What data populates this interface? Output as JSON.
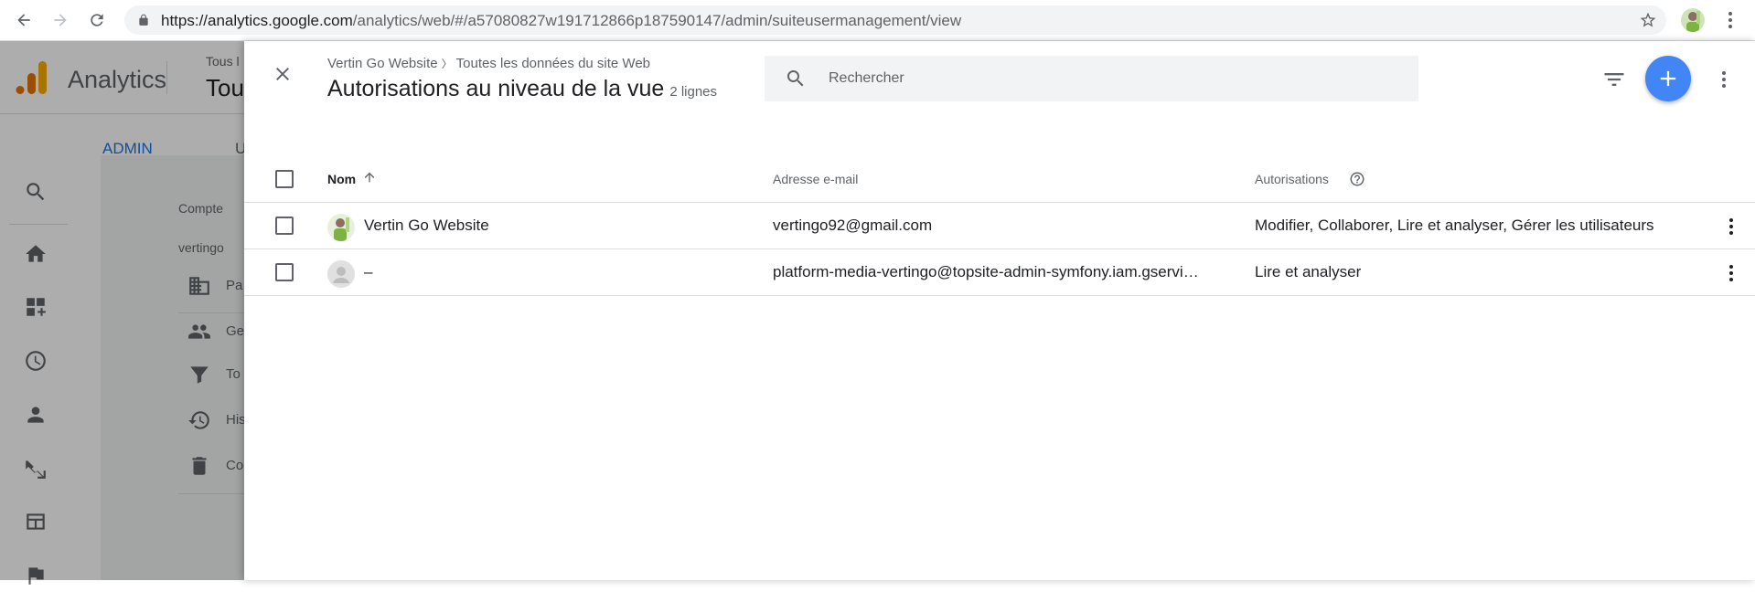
{
  "browser": {
    "url_host": "https://analytics.google.com",
    "url_path": "/analytics/web/#/a57080827w191712866p187590147/admin/suiteusermanagement/view"
  },
  "background": {
    "product_name": "Analytics",
    "account_small": "Tous l",
    "account_big": "Tou",
    "tab_admin": "ADMIN",
    "tab_u": "U",
    "compte_label": "Compte",
    "account_name": "vertingo",
    "menu_items": [
      "Pa",
      "Ge",
      "To",
      "His",
      "Co"
    ]
  },
  "panel": {
    "breadcrumb": [
      "Vertin Go Website",
      "Toutes les données du site Web"
    ],
    "title": "Autorisations au niveau de la vue",
    "count": "2 lignes",
    "search_placeholder": "Rechercher"
  },
  "table": {
    "columns": {
      "name": "Nom",
      "email": "Adresse e-mail",
      "permissions": "Autorisations"
    },
    "rows": [
      {
        "name": "Vertin Go Website",
        "email": "vertingo92@gmail.com",
        "permissions": "Modifier, Collaborer, Lire et analyser, Gérer les utilisateurs"
      },
      {
        "name": "–",
        "email": "platform-media-vertingo@topsite-admin-symfony.iam.gservi…",
        "permissions": "Lire et analyser"
      }
    ]
  },
  "colors": {
    "accent": "#4285f4",
    "link_blue": "#1a73e8",
    "analytics_orange": "#f9ab00",
    "analytics_dark_orange": "#e37400"
  }
}
